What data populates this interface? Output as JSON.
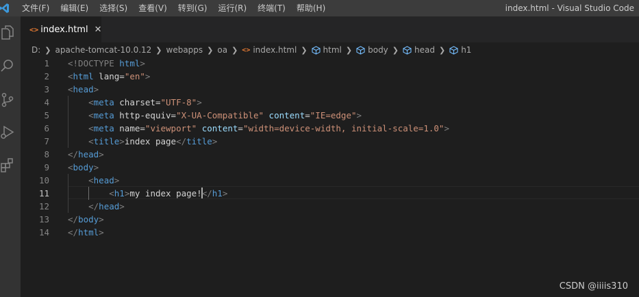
{
  "menu": [
    "文件(F)",
    "编辑(E)",
    "选择(S)",
    "查看(V)",
    "转到(G)",
    "运行(R)",
    "终端(T)",
    "帮助(H)"
  ],
  "window_title": "index.html - Visual Studio Code",
  "activity_icons": [
    "files-icon",
    "search-icon",
    "source-control-icon",
    "run-debug-icon",
    "extensions-icon"
  ],
  "tab": {
    "label": "index.html",
    "close": "✕",
    "icon": "<>"
  },
  "breadcrumb": [
    "D:",
    "apache-tomcat-10.0.12",
    "webapps",
    "oa",
    "index.html",
    "html",
    "body",
    "head",
    "h1"
  ],
  "code_lines": [
    {
      "n": "1",
      "code": "<!DOCTYPE html>"
    },
    {
      "n": "2",
      "code": "<html lang=\"en\">"
    },
    {
      "n": "3",
      "code": "<head>"
    },
    {
      "n": "4",
      "code": "    <meta charset=\"UTF-8\">"
    },
    {
      "n": "5",
      "code": "    <meta http-equiv=\"X-UA-Compatible\" content=\"IE=edge\">"
    },
    {
      "n": "6",
      "code": "    <meta name=\"viewport\" content=\"width=device-width, initial-scale=1.0\">"
    },
    {
      "n": "7",
      "code": "    <title>index page</title>"
    },
    {
      "n": "8",
      "code": "</head>"
    },
    {
      "n": "9",
      "code": "<body>"
    },
    {
      "n": "10",
      "code": "    <head>"
    },
    {
      "n": "11",
      "code": "        <h1>my index page!</h1>"
    },
    {
      "n": "12",
      "code": "    </head>"
    },
    {
      "n": "13",
      "code": "</body>"
    },
    {
      "n": "14",
      "code": "</html>"
    }
  ],
  "active_line": "11",
  "watermark": "CSDN @iiiis310",
  "colors": {
    "tag": "#569cd6",
    "attr": "#9cdcfe",
    "string": "#ce9178",
    "punct": "#808080",
    "text": "#d4d4d4",
    "file_icon": "#e37933",
    "vscode_blue": "#007acc"
  }
}
